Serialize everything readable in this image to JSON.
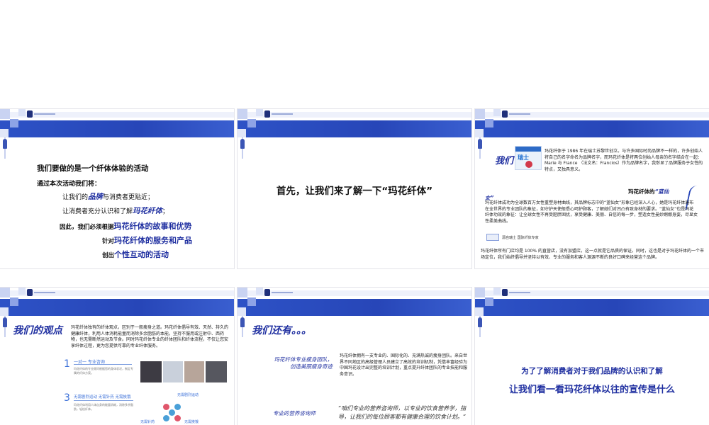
{
  "colors": {
    "accent": "#1f2fa0",
    "band": "#2746b8"
  },
  "slide1": {
    "line1": "我们要做的是一个纤体体验的活动",
    "line2": "通过本次活动我们将：",
    "line3_pre": "让我们的",
    "line3_em": "品牌",
    "line3_post": "与消费者更贴近；",
    "line4_pre": "让消费者充分认识和了解",
    "line4_em": "玛花纤体",
    "line4_post": "；",
    "line5_pre": "因此，我们必须根据",
    "line5_em": "玛花纤体的故事和优势",
    "line6_pre": "针对",
    "line6_em": "玛花纤体的服务和产品",
    "line7_pre": "创出",
    "line7_em": "个性互动的活动"
  },
  "slide2": {
    "heading": "首先，让我们来了解一下“玛花纤体”"
  },
  "slide3": {
    "title": "我们",
    "pic_word": "瑞士",
    "para1": "玛花纤体于 1986 年在瑞士苏黎世创立。与许多国际时尚品牌不一样的，许多创始人将自己的名字命名为品牌名字，而玛花纤体是将两位创始人母亲的名字结合在一起：Marie 与 France （法文名：Francios）作为品牌名字，我彰显了品牌服务于女性的特点，又独具意义。",
    "heading2_pre": "玛花纤体的",
    "heading2_em": "“蓝仙",
    "heading2_em2": "女”",
    "para2": "玛花纤体成功为全球数百万女性重塑身材曲线，其品牌标志中的“蓝仙女”形象已经深入人心，她是玛花纤体遍布在全世界的专业团队的象征，如守护天使般悉心呵护顾客，了解她们对凹凸有致身材的要求。“蓝仙女”也是玛花纤体功效的象征：让全球女性不再受肥胖困扰，享受健康、美丽、自信的每一步，塑造女性曼妙婀娜身姿，尽显女性柔美曲线。",
    "badge_text": "源自瑞士  国际纤体专家",
    "para3": "玛花纤体所有门店均是 100% 的直营店，没有加盟店，这一点就是它品质的保证。同时，这也是对于玛花纤体的一个市场定位，我们始终倡导并坚持以有效、专业的服务和客人源源不断的良好口碑来经营这个品牌。"
  },
  "slide4": {
    "title": "我们的观点",
    "para": "玛花纤体独有的纤体观点，区别于一般瘦身之道。玛花纤体倡导有效、天然、持久的健康纤体，利用人体消耗能量而消除多余脂肪的本能，坚持不服用或注射中、西药物，也无需断然运动及节食。同时玛花纤体专业的纤体团队和纤体流程，不仅让您安享纤体过程，更为您提供可靠的专业纤体服务。",
    "item1_num": "1",
    "item1_label": "一对一 专业咨询",
    "item1_small": "玛花纤体的专业顾问根据您的身体状况，制定专属的纤体方案。",
    "item3_num": "3",
    "item3_label": "无需剧烈运动 无需针药 无需挨饿",
    "item3_small": "玛花纤体利用人体自身的能量消耗，消除多余脂肪，轻松纤体。",
    "diag_top": "无需剧烈运动",
    "diag_left": "无需针药",
    "diag_right": "无需挨饿"
  },
  "slide5": {
    "title": "我们还有。。。",
    "left1_line1": "玛花纤体专业瘦身团队，",
    "left1_line2": "创造美丽瘦身奇迹",
    "para": "玛花纤体拥有一支专业的、国际化的、充满热诚的瘦身团队。来自世界不同地区的高级管理人员建立了高效的培训机制，凭借丰富经验为中国玛花设计出完整的培训计划，重点提升纤体团队的专业技能和服务意识。",
    "left2": "专业的营养咨询师",
    "handwriting": "“咱们专业的营养咨询师，以专业的饮食营养学，指导，让我们的每位顾客都有健康合理的饮食计划。”"
  },
  "slide6": {
    "line1": "为了了解消费者对于我们品牌的认识和了解",
    "line2": "让我们看一看玛花纤体以往的宣传是什么"
  }
}
